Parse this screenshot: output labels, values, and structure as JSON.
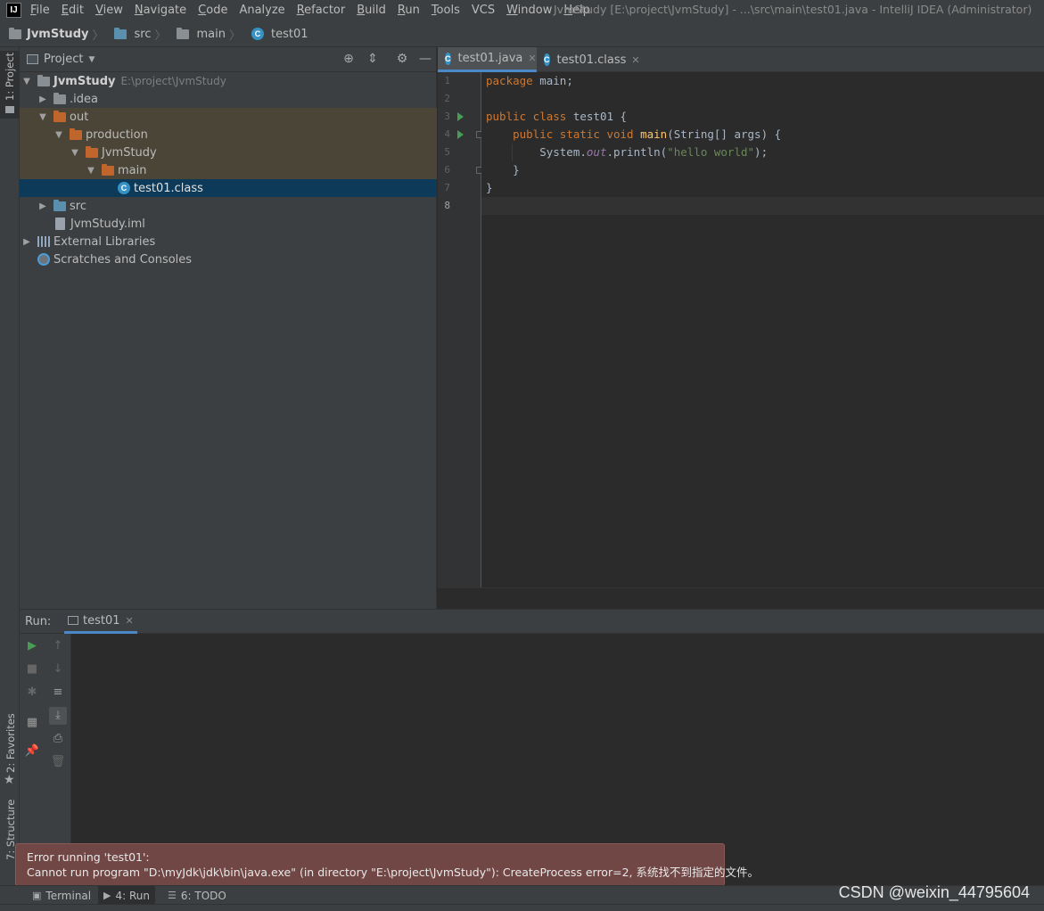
{
  "menubar": {
    "app_icon": "IJ",
    "items": [
      {
        "label": "File",
        "u": "F",
        "rest": "ile"
      },
      {
        "label": "Edit",
        "u": "E",
        "rest": "dit"
      },
      {
        "label": "View",
        "u": "V",
        "rest": "iew"
      },
      {
        "label": "Navigate",
        "u": "N",
        "rest": "avigate"
      },
      {
        "label": "Code",
        "u": "C",
        "rest": "ode"
      },
      {
        "label": "Analyze",
        "u": "",
        "rest": "Analyze"
      },
      {
        "label": "Refactor",
        "u": "R",
        "rest": "efactor"
      },
      {
        "label": "Build",
        "u": "B",
        "rest": "uild"
      },
      {
        "label": "Run",
        "u": "R",
        "rest": "un"
      },
      {
        "label": "Tools",
        "u": "T",
        "rest": "ools"
      },
      {
        "label": "VCS",
        "u": "",
        "rest": "VCS"
      },
      {
        "label": "Window",
        "u": "W",
        "rest": "indow"
      },
      {
        "label": "Help",
        "u": "H",
        "rest": "elp"
      }
    ],
    "window_title": "JvmStudy [E:\\project\\JvmStudy] - ...\\src\\main\\test01.java - IntelliJ IDEA (Administrator)"
  },
  "breadcrumb": {
    "project": "JvmStudy",
    "src": "src",
    "main": "main",
    "file": "test01"
  },
  "left_strip": {
    "project_tab": "1: Project",
    "favorites_tab": "2: Favorites",
    "structure_tab": "7: Structure"
  },
  "project_panel": {
    "title": "Project",
    "tree": {
      "root": "JvmStudy",
      "root_path": "E:\\project\\JvmStudy",
      "idea": ".idea",
      "out": "out",
      "production": "production",
      "jvmstudy": "JvmStudy",
      "main": "main",
      "class_file": "test01.class",
      "src": "src",
      "iml": "JvmStudy.iml",
      "libraries": "External Libraries",
      "scratches": "Scratches and Consoles"
    }
  },
  "editor": {
    "tabs": [
      {
        "label": "test01.java",
        "active": true
      },
      {
        "label": "test01.class",
        "active": false
      }
    ],
    "line_numbers": [
      "1",
      "2",
      "3",
      "4",
      "5",
      "6",
      "7",
      "8"
    ],
    "code": {
      "l1_kw": "package",
      "l1_rest": " main;",
      "l3_kw": "public class",
      "l3_rest": " test01 {",
      "l4_indent": "    ",
      "l4_kw": "public static void",
      "l4_fn": "main",
      "l4_rest": "(String[] args) {",
      "l5_indent": "        System.",
      "l5_field": "out",
      "l5_call": ".println(",
      "l5_str": "\"hello world\"",
      "l5_end": ");",
      "l6": "    }",
      "l7": "}"
    }
  },
  "run_panel": {
    "title": "Run:",
    "tab_label": "test01"
  },
  "error": {
    "title": "Error running 'test01':",
    "message": "Cannot run program \"D:\\myJdk\\jdk\\bin\\java.exe\" (in directory \"E:\\project\\JvmStudy\"): CreateProcess error=2, 系统找不到指定的文件。"
  },
  "bottom_bar": {
    "terminal": "Terminal",
    "run": "4: Run",
    "todo": "6: TODO"
  },
  "watermark": "CSDN @weixin_44795604",
  "colors": {
    "keyword": "#cc7832",
    "function": "#ffc66d",
    "string": "#6a8759",
    "field": "#9876aa",
    "selection": "#0d3a58",
    "error_bg": "#704745"
  }
}
